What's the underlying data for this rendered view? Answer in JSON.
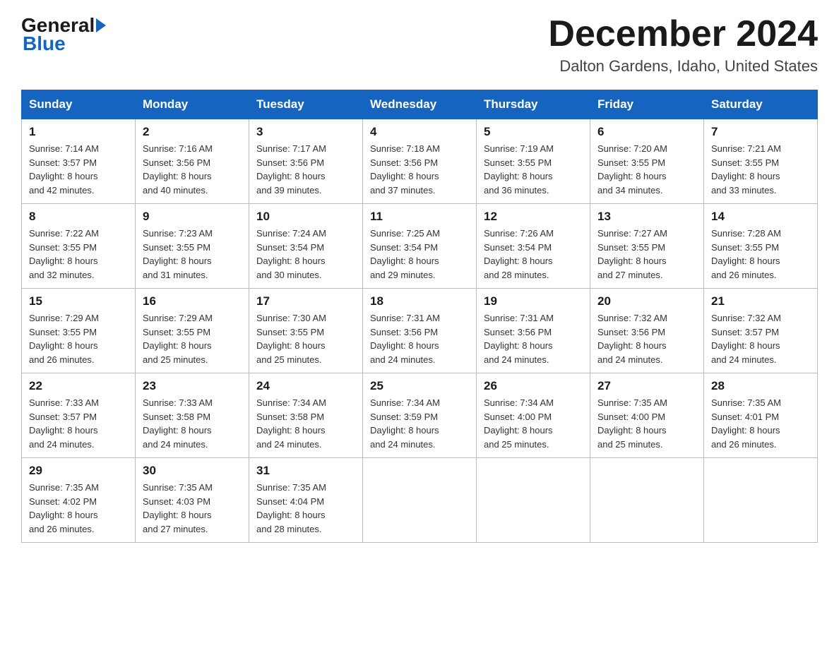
{
  "header": {
    "logo_general": "General",
    "logo_blue": "Blue",
    "month_title": "December 2024",
    "location": "Dalton Gardens, Idaho, United States"
  },
  "days_of_week": [
    "Sunday",
    "Monday",
    "Tuesday",
    "Wednesday",
    "Thursday",
    "Friday",
    "Saturday"
  ],
  "weeks": [
    [
      {
        "day": "1",
        "sunrise": "7:14 AM",
        "sunset": "3:57 PM",
        "daylight": "8 hours and 42 minutes."
      },
      {
        "day": "2",
        "sunrise": "7:16 AM",
        "sunset": "3:56 PM",
        "daylight": "8 hours and 40 minutes."
      },
      {
        "day": "3",
        "sunrise": "7:17 AM",
        "sunset": "3:56 PM",
        "daylight": "8 hours and 39 minutes."
      },
      {
        "day": "4",
        "sunrise": "7:18 AM",
        "sunset": "3:56 PM",
        "daylight": "8 hours and 37 minutes."
      },
      {
        "day": "5",
        "sunrise": "7:19 AM",
        "sunset": "3:55 PM",
        "daylight": "8 hours and 36 minutes."
      },
      {
        "day": "6",
        "sunrise": "7:20 AM",
        "sunset": "3:55 PM",
        "daylight": "8 hours and 34 minutes."
      },
      {
        "day": "7",
        "sunrise": "7:21 AM",
        "sunset": "3:55 PM",
        "daylight": "8 hours and 33 minutes."
      }
    ],
    [
      {
        "day": "8",
        "sunrise": "7:22 AM",
        "sunset": "3:55 PM",
        "daylight": "8 hours and 32 minutes."
      },
      {
        "day": "9",
        "sunrise": "7:23 AM",
        "sunset": "3:55 PM",
        "daylight": "8 hours and 31 minutes."
      },
      {
        "day": "10",
        "sunrise": "7:24 AM",
        "sunset": "3:54 PM",
        "daylight": "8 hours and 30 minutes."
      },
      {
        "day": "11",
        "sunrise": "7:25 AM",
        "sunset": "3:54 PM",
        "daylight": "8 hours and 29 minutes."
      },
      {
        "day": "12",
        "sunrise": "7:26 AM",
        "sunset": "3:54 PM",
        "daylight": "8 hours and 28 minutes."
      },
      {
        "day": "13",
        "sunrise": "7:27 AM",
        "sunset": "3:55 PM",
        "daylight": "8 hours and 27 minutes."
      },
      {
        "day": "14",
        "sunrise": "7:28 AM",
        "sunset": "3:55 PM",
        "daylight": "8 hours and 26 minutes."
      }
    ],
    [
      {
        "day": "15",
        "sunrise": "7:29 AM",
        "sunset": "3:55 PM",
        "daylight": "8 hours and 26 minutes."
      },
      {
        "day": "16",
        "sunrise": "7:29 AM",
        "sunset": "3:55 PM",
        "daylight": "8 hours and 25 minutes."
      },
      {
        "day": "17",
        "sunrise": "7:30 AM",
        "sunset": "3:55 PM",
        "daylight": "8 hours and 25 minutes."
      },
      {
        "day": "18",
        "sunrise": "7:31 AM",
        "sunset": "3:56 PM",
        "daylight": "8 hours and 24 minutes."
      },
      {
        "day": "19",
        "sunrise": "7:31 AM",
        "sunset": "3:56 PM",
        "daylight": "8 hours and 24 minutes."
      },
      {
        "day": "20",
        "sunrise": "7:32 AM",
        "sunset": "3:56 PM",
        "daylight": "8 hours and 24 minutes."
      },
      {
        "day": "21",
        "sunrise": "7:32 AM",
        "sunset": "3:57 PM",
        "daylight": "8 hours and 24 minutes."
      }
    ],
    [
      {
        "day": "22",
        "sunrise": "7:33 AM",
        "sunset": "3:57 PM",
        "daylight": "8 hours and 24 minutes."
      },
      {
        "day": "23",
        "sunrise": "7:33 AM",
        "sunset": "3:58 PM",
        "daylight": "8 hours and 24 minutes."
      },
      {
        "day": "24",
        "sunrise": "7:34 AM",
        "sunset": "3:58 PM",
        "daylight": "8 hours and 24 minutes."
      },
      {
        "day": "25",
        "sunrise": "7:34 AM",
        "sunset": "3:59 PM",
        "daylight": "8 hours and 24 minutes."
      },
      {
        "day": "26",
        "sunrise": "7:34 AM",
        "sunset": "4:00 PM",
        "daylight": "8 hours and 25 minutes."
      },
      {
        "day": "27",
        "sunrise": "7:35 AM",
        "sunset": "4:00 PM",
        "daylight": "8 hours and 25 minutes."
      },
      {
        "day": "28",
        "sunrise": "7:35 AM",
        "sunset": "4:01 PM",
        "daylight": "8 hours and 26 minutes."
      }
    ],
    [
      {
        "day": "29",
        "sunrise": "7:35 AM",
        "sunset": "4:02 PM",
        "daylight": "8 hours and 26 minutes."
      },
      {
        "day": "30",
        "sunrise": "7:35 AM",
        "sunset": "4:03 PM",
        "daylight": "8 hours and 27 minutes."
      },
      {
        "day": "31",
        "sunrise": "7:35 AM",
        "sunset": "4:04 PM",
        "daylight": "8 hours and 28 minutes."
      },
      null,
      null,
      null,
      null
    ]
  ],
  "labels": {
    "sunrise_prefix": "Sunrise: ",
    "sunset_prefix": "Sunset: ",
    "daylight_prefix": "Daylight: "
  }
}
